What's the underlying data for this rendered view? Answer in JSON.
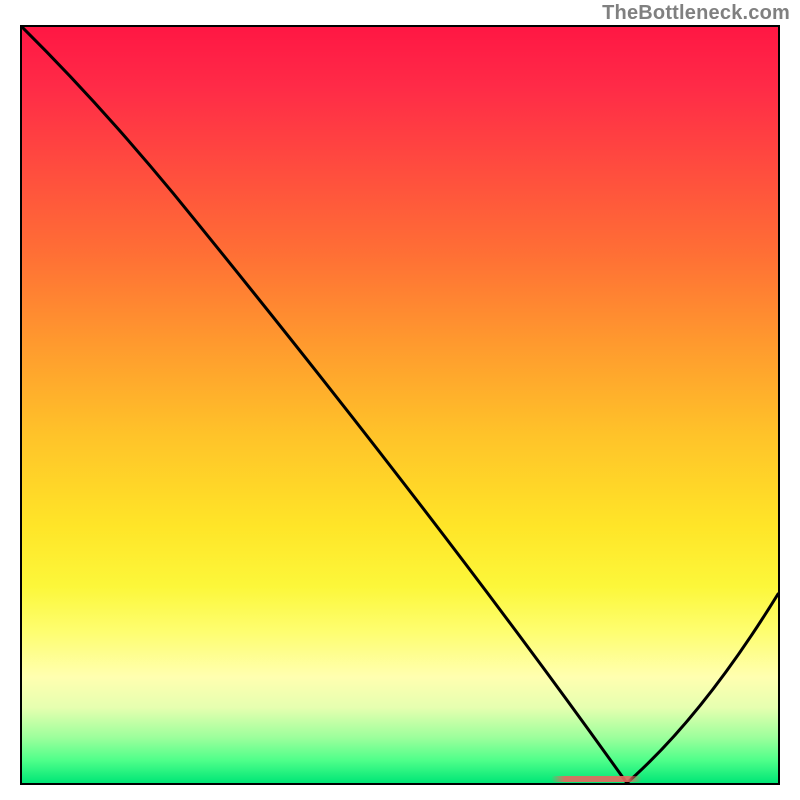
{
  "watermark": "TheBottleneck.com",
  "colors": {
    "border": "#000000",
    "curve": "#000000",
    "flat_marker": "#e6695f"
  },
  "chart_data": {
    "type": "line",
    "title": "",
    "xlabel": "",
    "ylabel": "",
    "xlim": [
      0,
      100
    ],
    "ylim": [
      0,
      100
    ],
    "x": [
      0,
      20,
      80,
      100
    ],
    "values": [
      100,
      78,
      0,
      25
    ],
    "annotations": [
      {
        "kind": "flat_segment_marker",
        "x_start": 70,
        "x_end": 82,
        "y": 0.5
      }
    ]
  }
}
